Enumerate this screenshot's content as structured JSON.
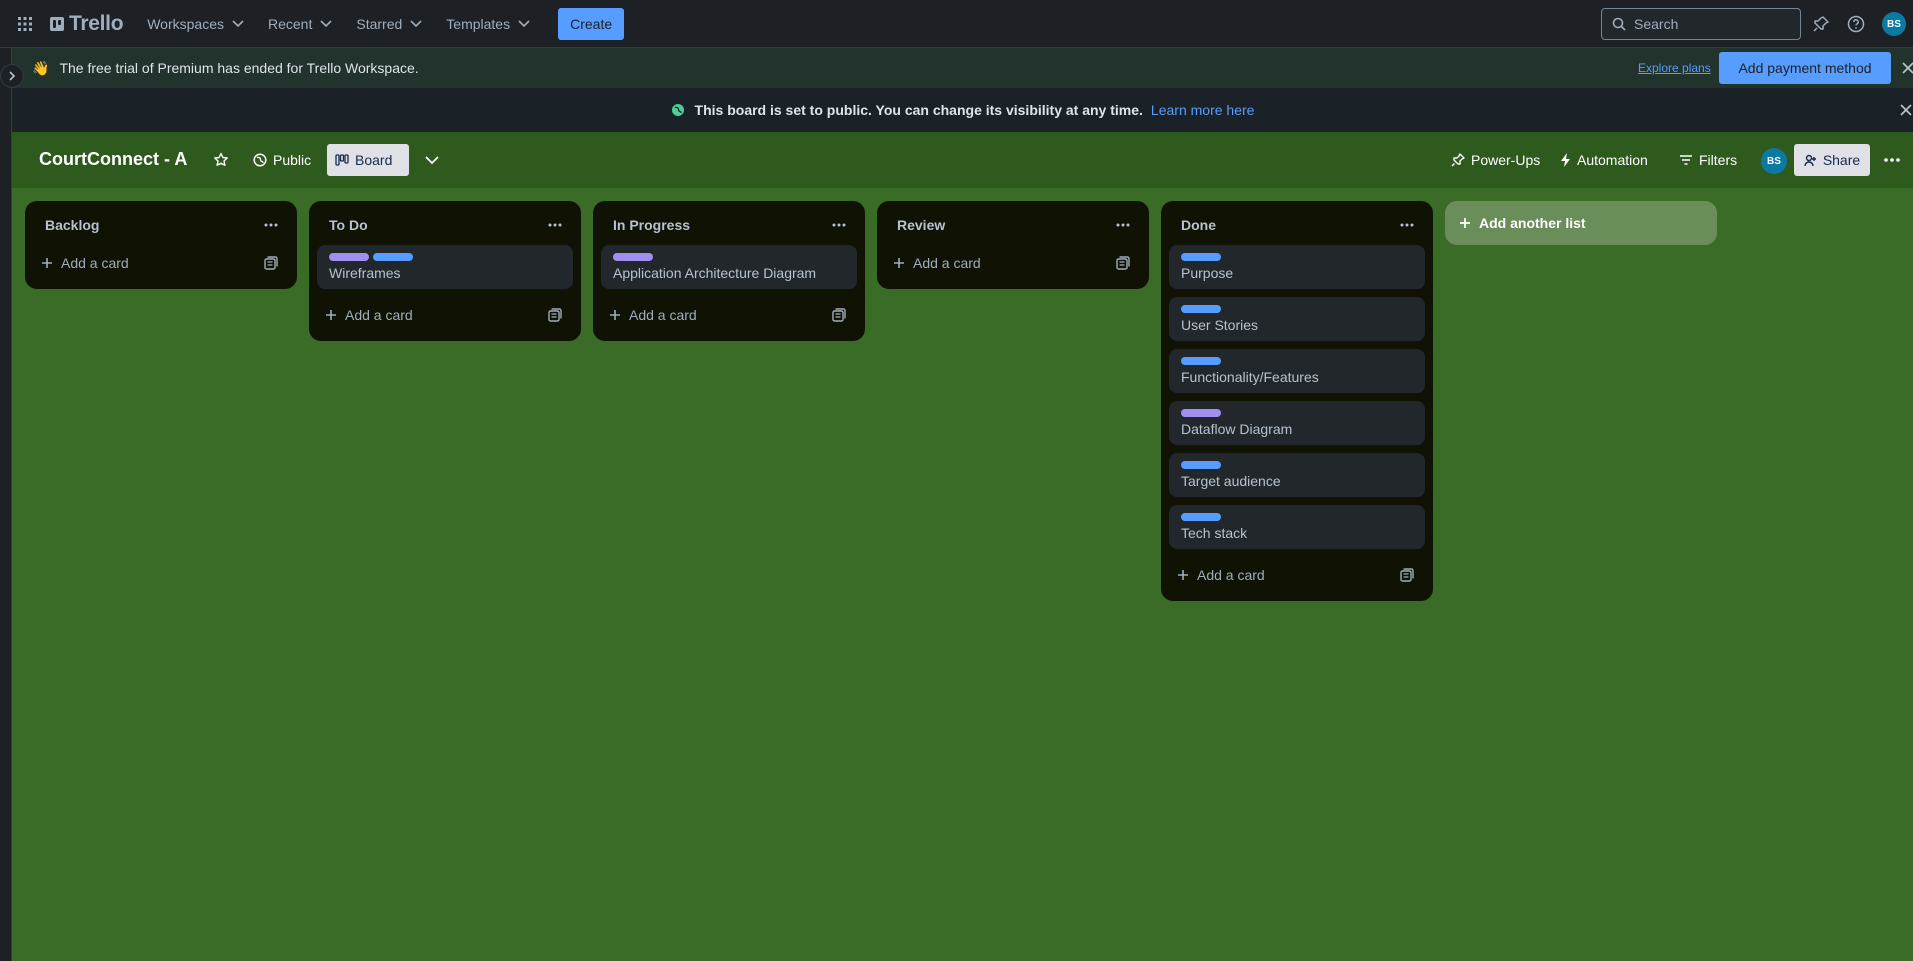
{
  "topnav": {
    "logo": "Trello",
    "menu": [
      {
        "label": "Workspaces"
      },
      {
        "label": "Recent"
      },
      {
        "label": "Starred"
      },
      {
        "label": "Templates"
      }
    ],
    "create_label": "Create",
    "search_placeholder": "Search",
    "avatar_initials": "BS"
  },
  "premium_banner": {
    "emoji": "👋",
    "text": "The free trial of Premium has ended for Trello Workspace.",
    "explore_label": "Explore plans",
    "pay_label": "Add payment method"
  },
  "public_banner": {
    "text": "This board is set to public. You can change its visibility at any time.",
    "learn_label": "Learn more here"
  },
  "board": {
    "title": "CourtConnect - A",
    "visibility_label": "Public",
    "view_label": "Board",
    "powerups_label": "Power-Ups",
    "automation_label": "Automation",
    "filters_label": "Filters",
    "avatar_initials": "BS",
    "share_label": "Share",
    "add_list_label": "Add another list",
    "label_colors": {
      "purple": "#9f8fef",
      "blue": "#579dff"
    }
  },
  "lists": [
    {
      "title": "Backlog",
      "add_label": "Add a card",
      "cards": []
    },
    {
      "title": "To Do",
      "add_label": "Add a card",
      "cards": [
        {
          "title": "Wireframes",
          "labels": [
            "purple",
            "blue"
          ]
        }
      ]
    },
    {
      "title": "In Progress",
      "add_label": "Add a card",
      "cards": [
        {
          "title": "Application Architecture Diagram",
          "labels": [
            "purple"
          ]
        }
      ]
    },
    {
      "title": "Review",
      "add_label": "Add a card",
      "cards": []
    },
    {
      "title": "Done",
      "add_label": "Add a card",
      "cards": [
        {
          "title": "Purpose",
          "labels": [
            "blue"
          ]
        },
        {
          "title": "User Stories",
          "labels": [
            "blue"
          ]
        },
        {
          "title": "Functionality/Features",
          "labels": [
            "blue"
          ]
        },
        {
          "title": "Dataflow Diagram",
          "labels": [
            "purple"
          ]
        },
        {
          "title": "Target audience",
          "labels": [
            "blue"
          ]
        },
        {
          "title": "Tech stack",
          "labels": [
            "blue"
          ]
        }
      ]
    }
  ]
}
